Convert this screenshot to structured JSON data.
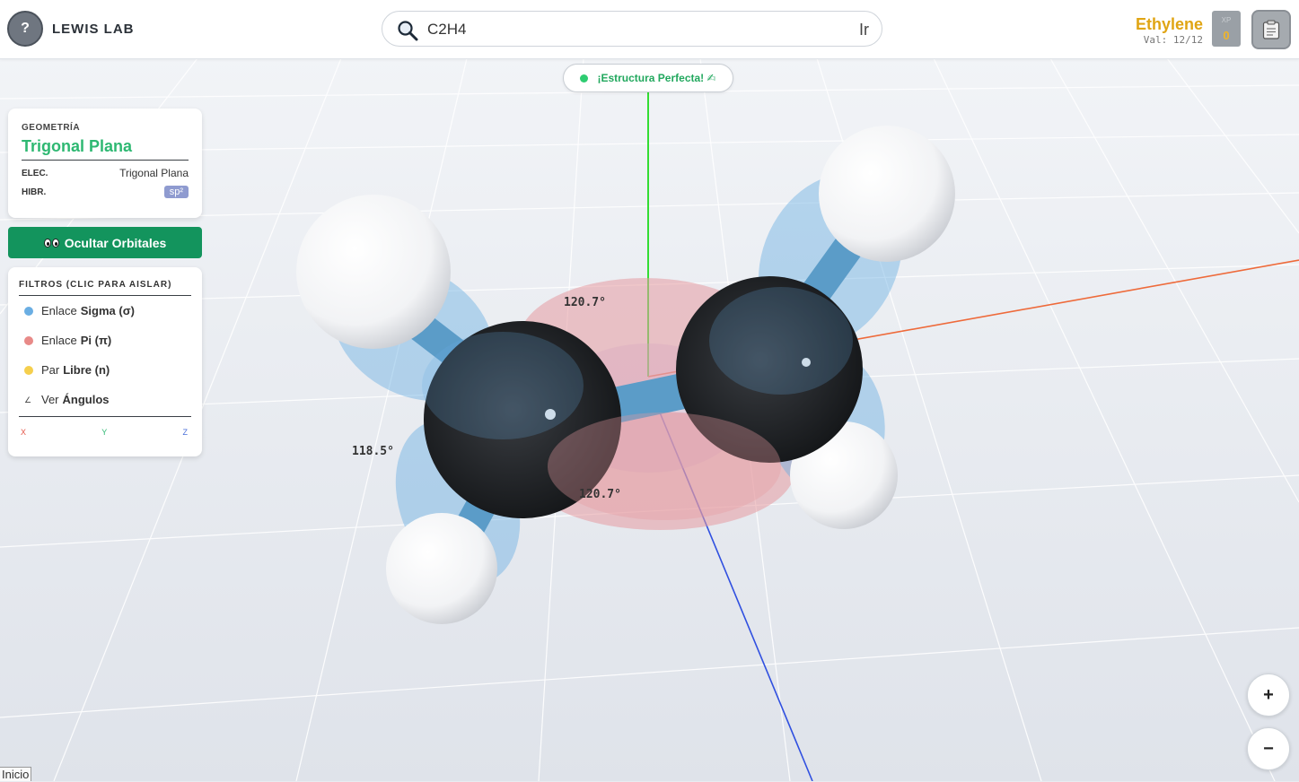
{
  "app": {
    "title": "LEWIS LAB",
    "help_label": "?"
  },
  "search": {
    "value": "C2H4",
    "go_label": "Ir"
  },
  "molecule": {
    "name": "Ethylene",
    "validity": "Val: 12/12"
  },
  "xp": {
    "label": "XP",
    "value": "0"
  },
  "status": {
    "text": "¡Estructura Perfecta! ✍"
  },
  "geometry": {
    "heading": "GEOMETRÍA",
    "value": "Trigonal Plana",
    "electronic_label": "ELEC.",
    "electronic_value": "Trigonal Plana",
    "hybrid_label": "HIBR.",
    "hybrid_value": "sp²"
  },
  "orbitals_toggle": {
    "label": "Ocultar Orbitales"
  },
  "filters": {
    "heading": "FILTROS (CLIC PARA AISLAR)",
    "items": [
      {
        "prefix": "Enlace",
        "bold": "Sigma (σ)",
        "color": "#6aaee3"
      },
      {
        "prefix": "Enlace",
        "bold": "Pi (π)",
        "color": "#e88a88"
      },
      {
        "prefix": "Par",
        "bold": "Libre (n)",
        "color": "#f5cf4d"
      },
      {
        "prefix": "Ver",
        "bold": "Ángulos",
        "icon": "angle-icon"
      }
    ],
    "axes": [
      "X",
      "Y",
      "Z"
    ]
  },
  "angles": [
    "120.7°",
    "118.5°",
    "120.7°"
  ],
  "zoom": {
    "in_label": "+",
    "out_label": "−"
  },
  "footer": {
    "home_label": "Inicio"
  },
  "colors": {
    "accent_green": "#2eb872",
    "button_green": "#13945d",
    "molecule_gold": "#e0a514",
    "axis_x": "#e4574a",
    "axis_y": "#2eb872",
    "axis_z": "#3050e0"
  }
}
